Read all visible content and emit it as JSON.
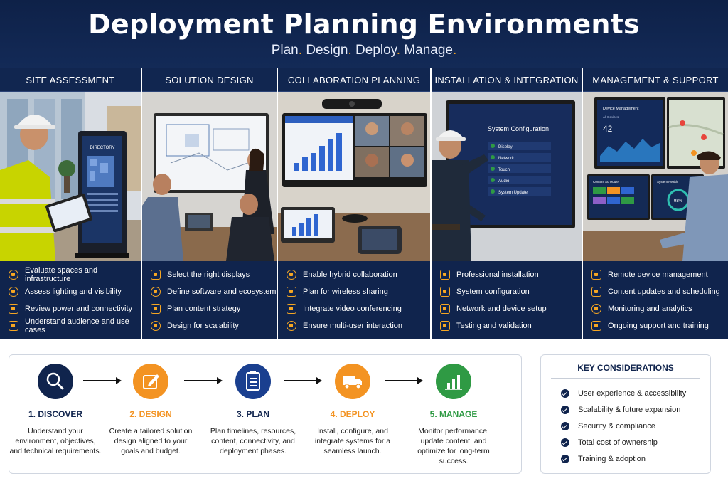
{
  "header": {
    "title": "Deployment Planning Environments",
    "tagline": [
      "Plan",
      "Design",
      "Deploy",
      "Manage"
    ]
  },
  "columns": [
    {
      "title": "SITE ASSESSMENT",
      "screen_text": "DIRECTORY",
      "items": [
        "Evaluate spaces and infrastructure",
        "Assess lighting and visibility",
        "Review power and connectivity",
        "Understand audience and use cases"
      ]
    },
    {
      "title": "SOLUTION DESIGN",
      "items": [
        "Select the right displays",
        "Define software and ecosystem",
        "Plan content strategy",
        "Design for scalability"
      ]
    },
    {
      "title": "COLLABORATION PLANNING",
      "items": [
        "Enable hybrid collaboration",
        "Plan for wireless sharing",
        "Integrate video conferencing",
        "Ensure multi-user interaction"
      ]
    },
    {
      "title": "INSTALLATION & INTEGRATION",
      "screen_title": "System Configuration",
      "screen_items": [
        "Display",
        "Network",
        "Touch",
        "Audio",
        "System Update"
      ],
      "items": [
        "Professional installation",
        "System configuration",
        "Network and device setup",
        "Testing and validation"
      ]
    },
    {
      "title": "MANAGEMENT & SUPPORT",
      "screen_title": "Device Management",
      "screen_sub": "All Devices",
      "screen_value": "42",
      "screen2_title": "Content Schedule",
      "screen3_title": "System Health",
      "screen3_value": "98%",
      "items": [
        "Remote device management",
        "Content updates and scheduling",
        "Monitoring and analytics",
        "Ongoing support and training"
      ]
    }
  ],
  "steps": [
    {
      "label": "1. DISCOVER",
      "desc": "Understand your environment, objectives, and technical requirements.",
      "color": "#10244d",
      "label_color": "#10244d",
      "icon": "magnifier-icon"
    },
    {
      "label": "2. DESIGN",
      "desc": "Create a tailored solution design aligned to your goals and budget.",
      "color": "#f39322",
      "label_color": "#f39322",
      "icon": "edit-icon"
    },
    {
      "label": "3. PLAN",
      "desc": "Plan timelines, resources, content, connectivity, and deployment phases.",
      "color": "#1a3f8f",
      "label_color": "#10244d",
      "icon": "clipboard-icon"
    },
    {
      "label": "4. DEPLOY",
      "desc": "Install, configure, and integrate systems for a seamless launch.",
      "color": "#f39322",
      "label_color": "#f39322",
      "icon": "truck-icon"
    },
    {
      "label": "5. MANAGE",
      "desc": "Monitor performance, update content, and optimize for long-term success.",
      "color": "#2f9a44",
      "label_color": "#2f9a44",
      "icon": "bar-chart-icon"
    }
  ],
  "considerations": {
    "title": "KEY CONSIDERATIONS",
    "items": [
      "User experience & accessibility",
      "Scalability & future expansion",
      "Security & compliance",
      "Total cost of ownership",
      "Training & adoption"
    ]
  },
  "colors": {
    "navy": "#10244d",
    "accent": "#f5a623",
    "green": "#2f9a44"
  }
}
